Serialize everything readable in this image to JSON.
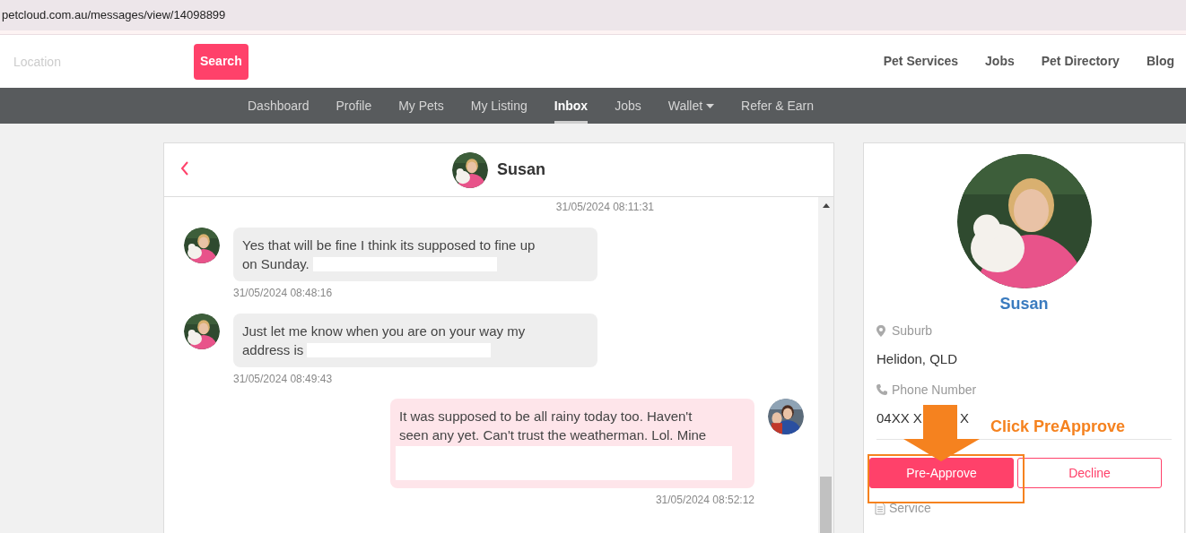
{
  "address_bar": {
    "url": "petcloud.com.au/messages/view/14098899"
  },
  "header": {
    "search": {
      "placeholder": "Location",
      "button": "Search"
    },
    "links": [
      "Pet Services",
      "Jobs",
      "Pet Directory",
      "Blog"
    ]
  },
  "nav": {
    "items": [
      {
        "label": "Dashboard",
        "selected": false,
        "kind": "link"
      },
      {
        "label": "Profile",
        "selected": false,
        "kind": "link"
      },
      {
        "label": "My Pets",
        "selected": false,
        "kind": "link"
      },
      {
        "label": "My Listing",
        "selected": false,
        "kind": "link"
      },
      {
        "label": "Inbox",
        "selected": true,
        "kind": "link"
      },
      {
        "label": "Jobs",
        "selected": false,
        "kind": "link"
      },
      {
        "label": "Wallet",
        "selected": false,
        "kind": "dropdown"
      },
      {
        "label": "Refer & Earn",
        "selected": false,
        "kind": "link"
      }
    ]
  },
  "chat": {
    "contact": "Susan",
    "earlier_timestamp": "31/05/2024 08:11:31",
    "messages": [
      {
        "kind": "incoming",
        "lines": [
          "Yes that will be fine I think its supposed to fine up",
          "on Sunday."
        ],
        "redacted": true,
        "time": "31/05/2024 08:48:16"
      },
      {
        "kind": "incoming",
        "lines": [
          "Just let me know when you are on your way my",
          "address is"
        ],
        "redacted": true,
        "time": "31/05/2024 08:49:43"
      },
      {
        "kind": "outgoing",
        "lines": [
          "It was supposed to be all rainy today too. Haven't",
          "seen any yet. Can't trust the weatherman. Lol. Mine"
        ],
        "redacted": true,
        "time": "31/05/2024 08:52:12"
      }
    ]
  },
  "profile": {
    "name": "Susan",
    "fields": [
      {
        "kind": "location",
        "label": "Suburb",
        "value": [
          "Helidon, QLD"
        ]
      },
      {
        "kind": "phone",
        "label": "Phone Number",
        "value": [
          "04XX X",
          "X"
        ]
      }
    ],
    "buttons": [
      {
        "kind": "primary",
        "label": "Pre-Approve"
      },
      {
        "kind": "outline",
        "label": "Decline"
      }
    ],
    "next_section": "Service"
  },
  "annotation": {
    "callout": "Click PreApprove"
  }
}
